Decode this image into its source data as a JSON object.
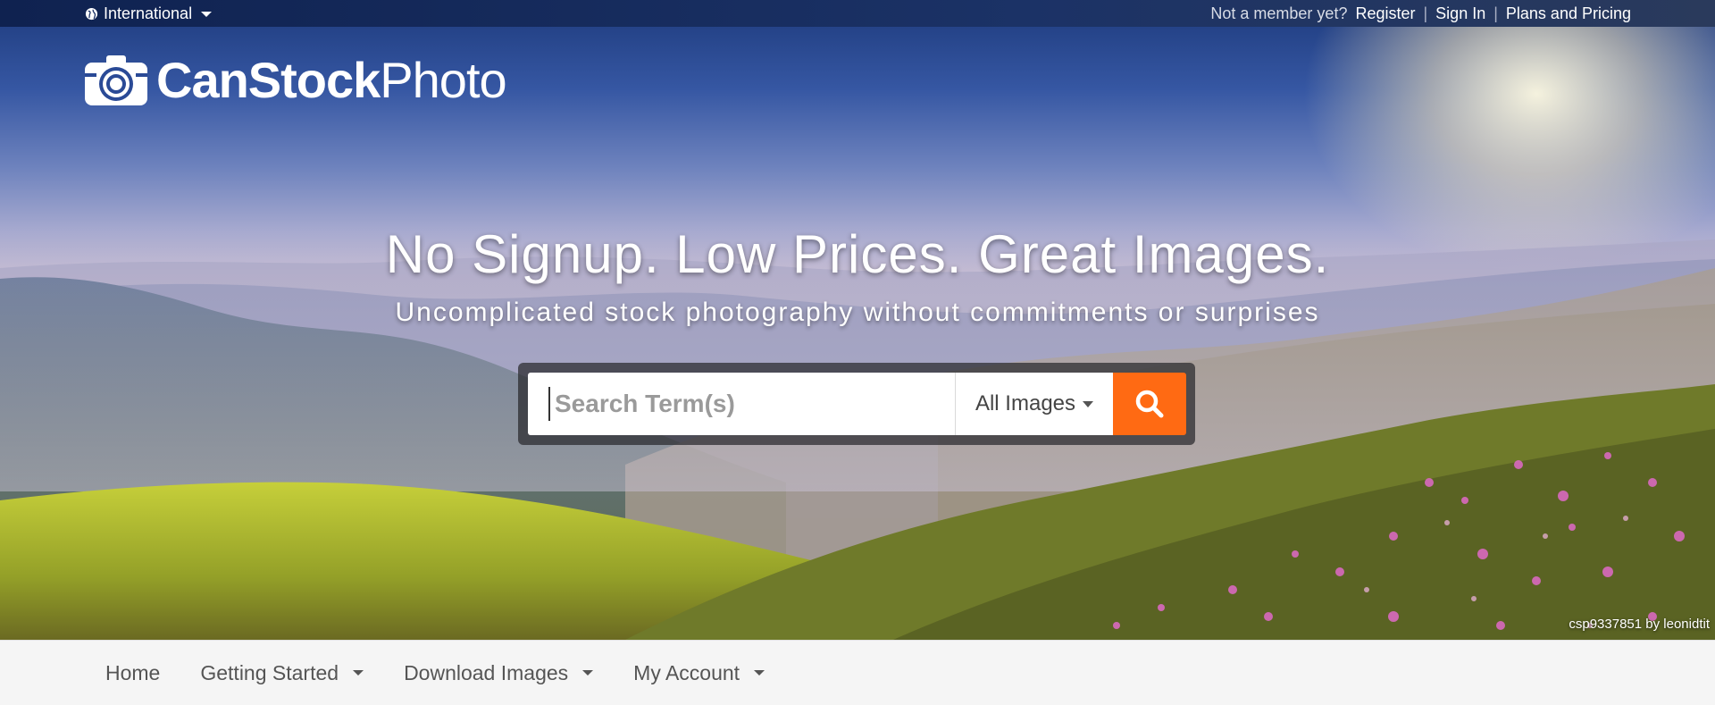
{
  "topbar": {
    "locale_label": "International",
    "member_prompt": "Not a member yet?",
    "register": "Register",
    "sign_in": "Sign In",
    "plans": "Plans and Pricing",
    "separator": "|"
  },
  "brand": {
    "name_bold": "CanStock",
    "name_light": "Photo"
  },
  "hero": {
    "headline": "No Signup. Low Prices. Great Images.",
    "subheadline": "Uncomplicated stock photography without commitments or surprises",
    "image_credit": "csp9337851 by leonidtit"
  },
  "search": {
    "placeholder": "Search Term(s)",
    "value": "",
    "type_selected": "All Images",
    "button_icon": "search-icon",
    "button_color": "#ff6a13"
  },
  "nav": {
    "items": [
      {
        "label": "Home",
        "dropdown": false
      },
      {
        "label": "Getting Started",
        "dropdown": true
      },
      {
        "label": "Download Images",
        "dropdown": true
      },
      {
        "label": "My Account",
        "dropdown": true
      }
    ]
  }
}
